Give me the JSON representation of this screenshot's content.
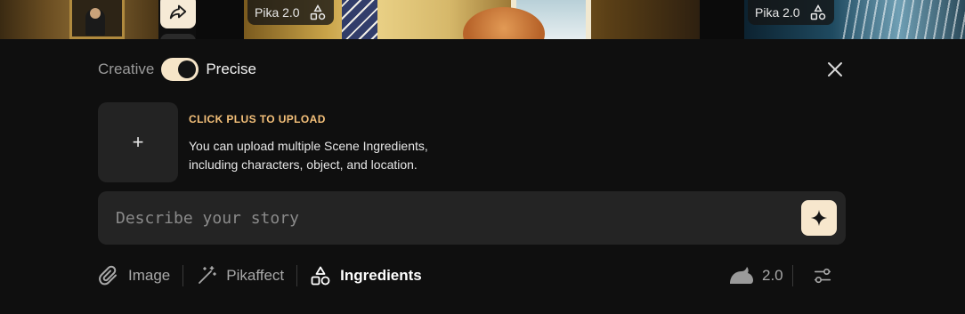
{
  "thumbnails": [
    {
      "badge": ""
    },
    {
      "badge": "Pika 2.0"
    },
    {
      "badge": "Pika 2.0"
    }
  ],
  "icons": {
    "share": "share-arrow-icon",
    "shapes": "shapes-icon",
    "close": "close-icon",
    "plus": "plus-icon",
    "sparkle": "sparkle-icon",
    "paperclip": "paperclip-icon",
    "wand": "magic-wand-icon",
    "rabbit": "rabbit-icon",
    "sliders": "sliders-icon"
  },
  "mode": {
    "left_label": "Creative",
    "right_label": "Precise",
    "selected": "Precise"
  },
  "upload": {
    "plus": "+",
    "title": "CLICK PLUS TO UPLOAD",
    "description": "You can upload multiple Scene Ingredients, including characters, object, and location."
  },
  "prompt": {
    "placeholder": "Describe your story",
    "value": ""
  },
  "tools": {
    "image": "Image",
    "pikaffect": "Pikaffect",
    "ingredients": "Ingredients",
    "active": "Ingredients"
  },
  "model": {
    "version": "2.0"
  },
  "colors": {
    "accent": "#f7e7cd",
    "upload_title": "#f5c17a",
    "background": "#0f0f0f",
    "surface": "#242424"
  }
}
